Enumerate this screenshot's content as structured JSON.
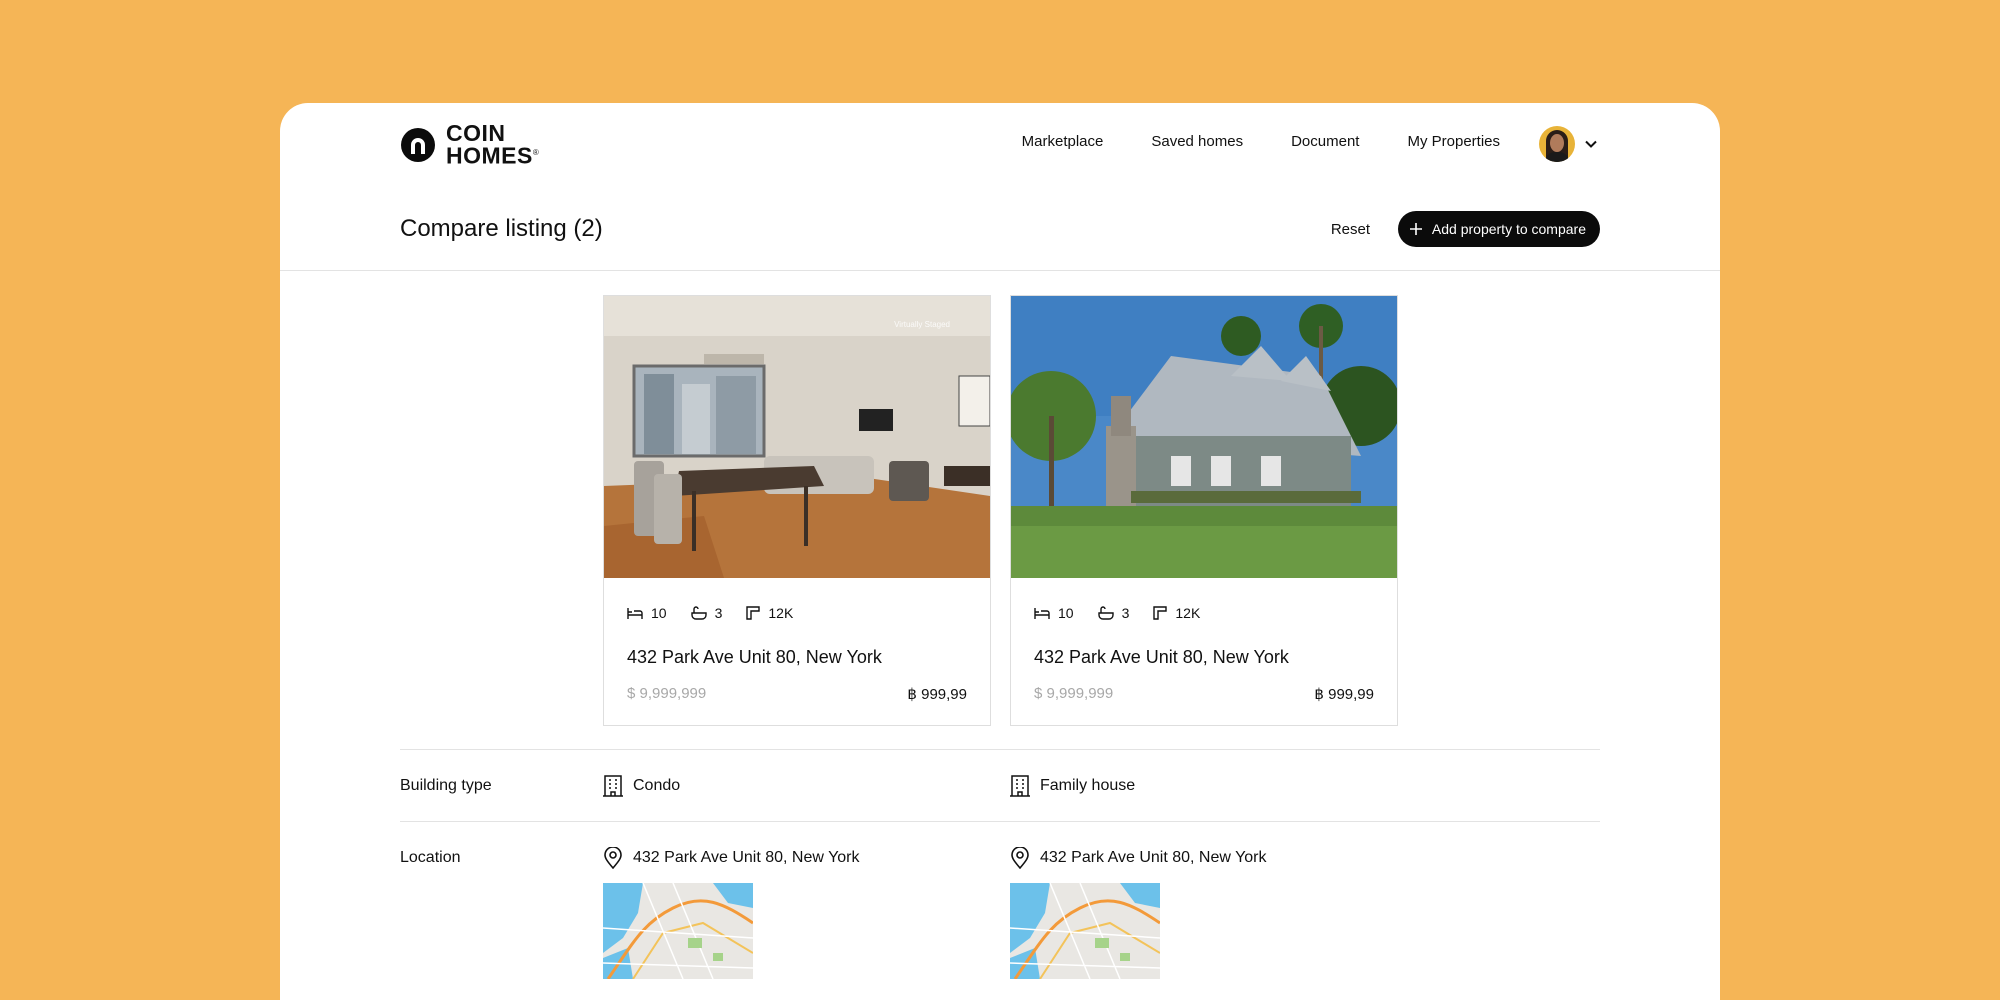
{
  "brand": {
    "line1": "COIN",
    "line2": "HOMES",
    "mark": "®"
  },
  "nav": {
    "items": [
      "Marketplace",
      "Saved homes",
      "Document",
      "My Properties"
    ]
  },
  "header": {
    "title": "Compare listing (2)",
    "reset_label": "Reset",
    "add_label": "Add property to compare"
  },
  "listings": [
    {
      "beds": "10",
      "baths": "3",
      "area": "12K",
      "address": "432 Park Ave Unit 80, New York",
      "price_usd": "$ 9,999,999",
      "price_btc": "฿ 999,99",
      "watermark": "Virtually Staged",
      "building_type": "Condo",
      "location": "432 Park Ave Unit 80, New York"
    },
    {
      "beds": "10",
      "baths": "3",
      "area": "12K",
      "address": "432 Park Ave Unit 80, New York",
      "price_usd": "$ 9,999,999",
      "price_btc": "฿ 999,99",
      "building_type": "Family house",
      "location": "432 Park Ave Unit 80, New York"
    }
  ],
  "rows": {
    "building_type_label": "Building type",
    "location_label": "Location"
  },
  "colors": {
    "background": "#F5B556",
    "button": "#0b0b0b",
    "muted": "#a8a8a8"
  }
}
